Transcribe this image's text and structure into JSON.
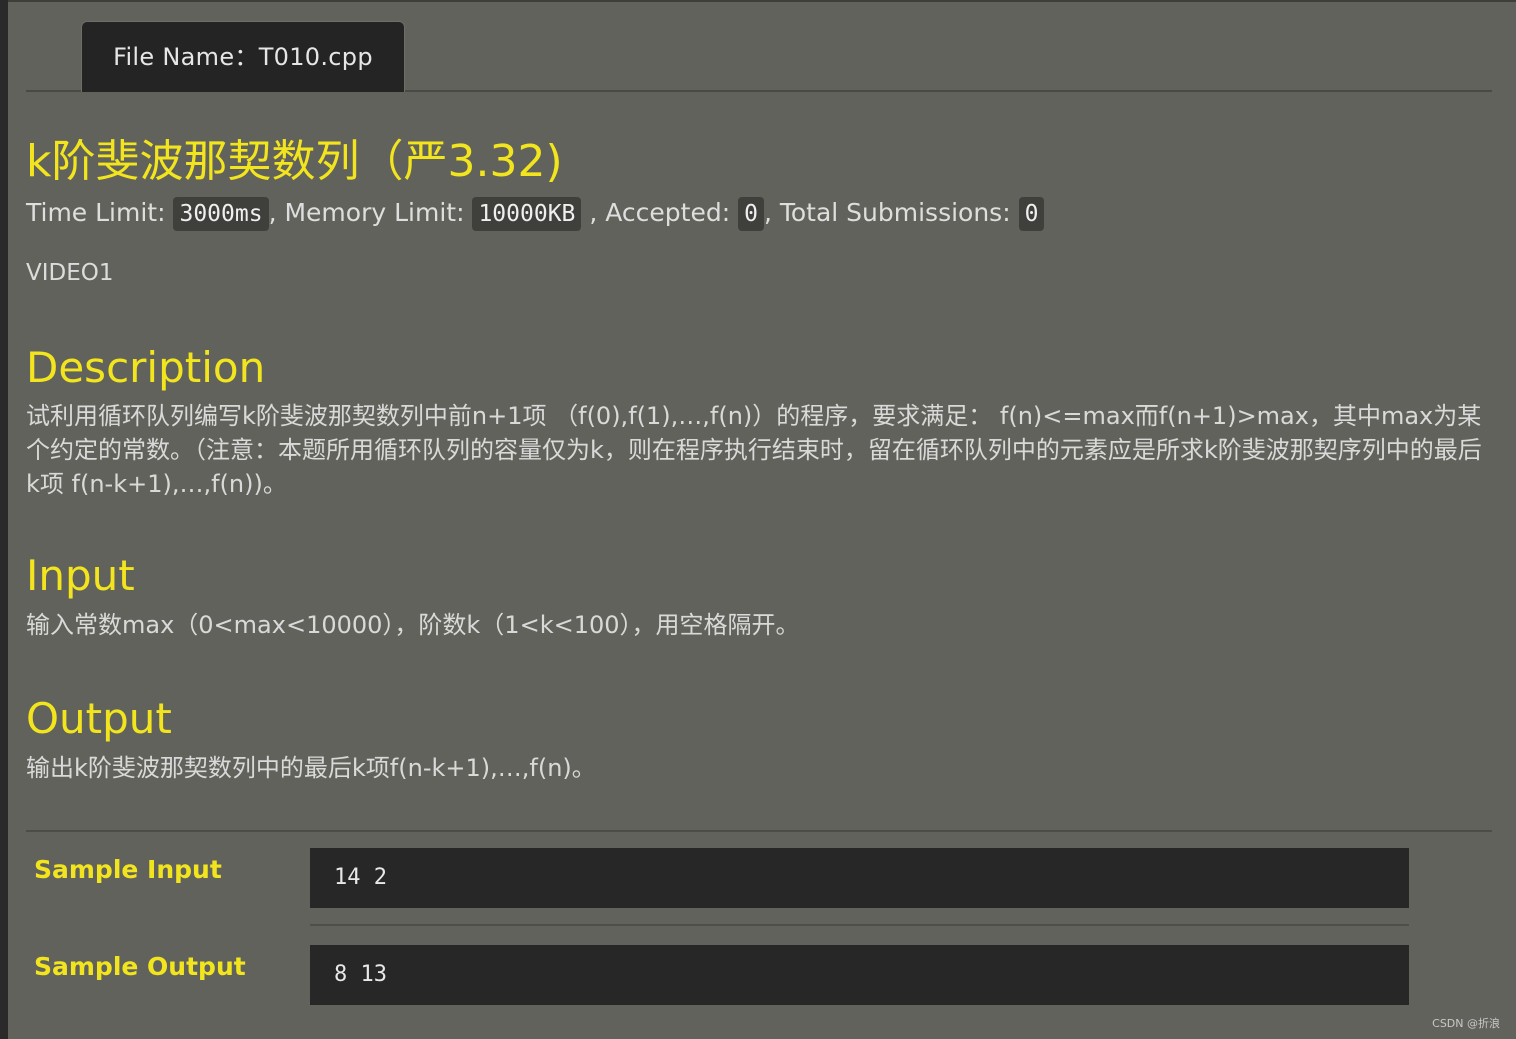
{
  "tab": {
    "file_name": "File Name：T010.cpp"
  },
  "problem": {
    "title": "k阶斐波那契数列（严3.32)",
    "time_limit_label": "Time Limit:",
    "time_limit": "3000ms",
    "memory_limit_label": ", Memory Limit:",
    "memory_limit": "10000KB",
    "accepted_label": ", Accepted:",
    "accepted": "0",
    "total_label": ", Total Submissions:",
    "total_submissions": "0",
    "video": "VIDEO1"
  },
  "sections": {
    "description": {
      "heading": "Description",
      "body": "试利用循环队列编写k阶斐波那契数列中前n+1项 （f(0),f(1),…,f(n)）的程序，要求满足： f(n)<=max而f(n+1)>max，其中max为某个约定的常数。（注意：本题所用循环队列的容量仅为k，则在程序执行结束时，留在循环队列中的元素应是所求k阶斐波那契序列中的最后k项 f(n-k+1),…,f(n))。"
    },
    "input": {
      "heading": "Input",
      "body": "输入常数max（0<max<10000），阶数k（1<k<100），用空格隔开。"
    },
    "output": {
      "heading": "Output",
      "body": "输出k阶斐波那契数列中的最后k项f(n-k+1),…,f(n)。"
    }
  },
  "samples": {
    "input_label": "Sample Input",
    "input_value": "14 2",
    "output_label": "Sample Output",
    "output_value": "8 13"
  },
  "watermark": "CSDN @折浪"
}
